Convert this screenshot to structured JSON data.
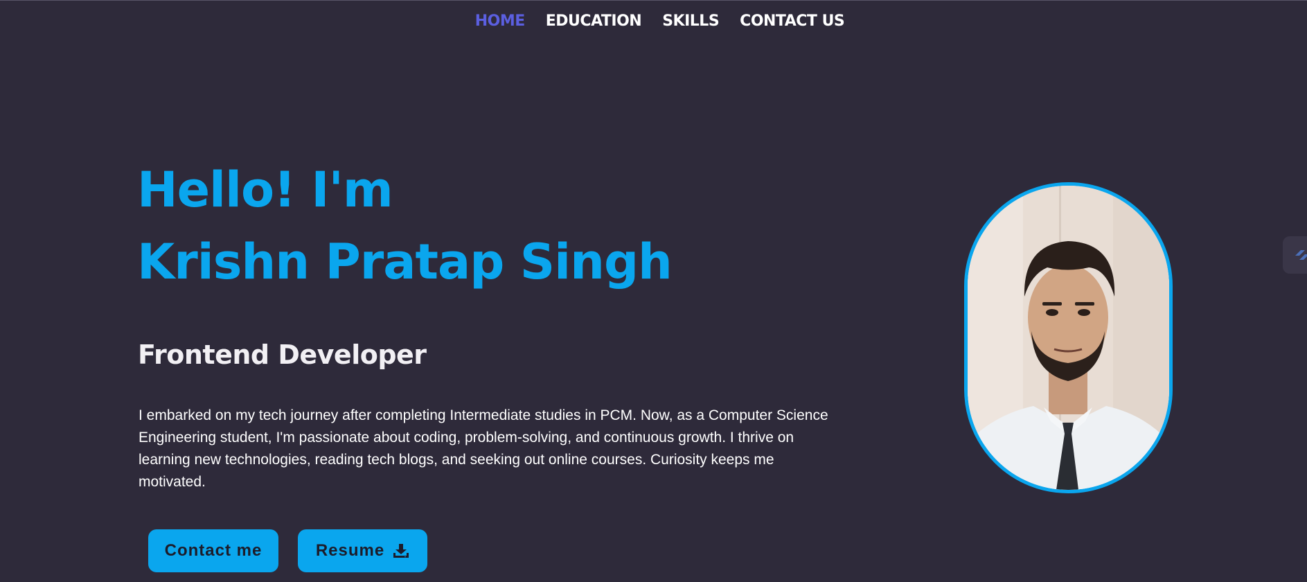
{
  "nav": {
    "items": [
      {
        "label": "HOME",
        "active": true
      },
      {
        "label": "EDUCATION",
        "active": false
      },
      {
        "label": "SKILLS",
        "active": false
      },
      {
        "label": "CONTACT US",
        "active": false
      }
    ]
  },
  "hero": {
    "greeting": "Hello! I'm",
    "name": "Krishn Pratap Singh",
    "role": "Frontend Developer",
    "bio": "I embarked on my tech journey after completing Intermediate studies in PCM. Now, as a Computer Science Engineering student, I'm passionate about coding, problem-solving, and continuous growth. I thrive on learning new technologies, reading tech blogs, and seeking out online courses. Curiosity keeps me motivated.",
    "contact_label": "Contact me",
    "resume_label": "Resume",
    "resume_icon": "download-icon"
  },
  "profile_photo": {
    "icon": "profile-photo"
  },
  "side_widget": {
    "icon": "extension-icon"
  },
  "colors": {
    "background": "#2e2a3a",
    "accent": "#0aa6ee",
    "nav_active": "#5b5fe0",
    "text": "#ffffff"
  }
}
